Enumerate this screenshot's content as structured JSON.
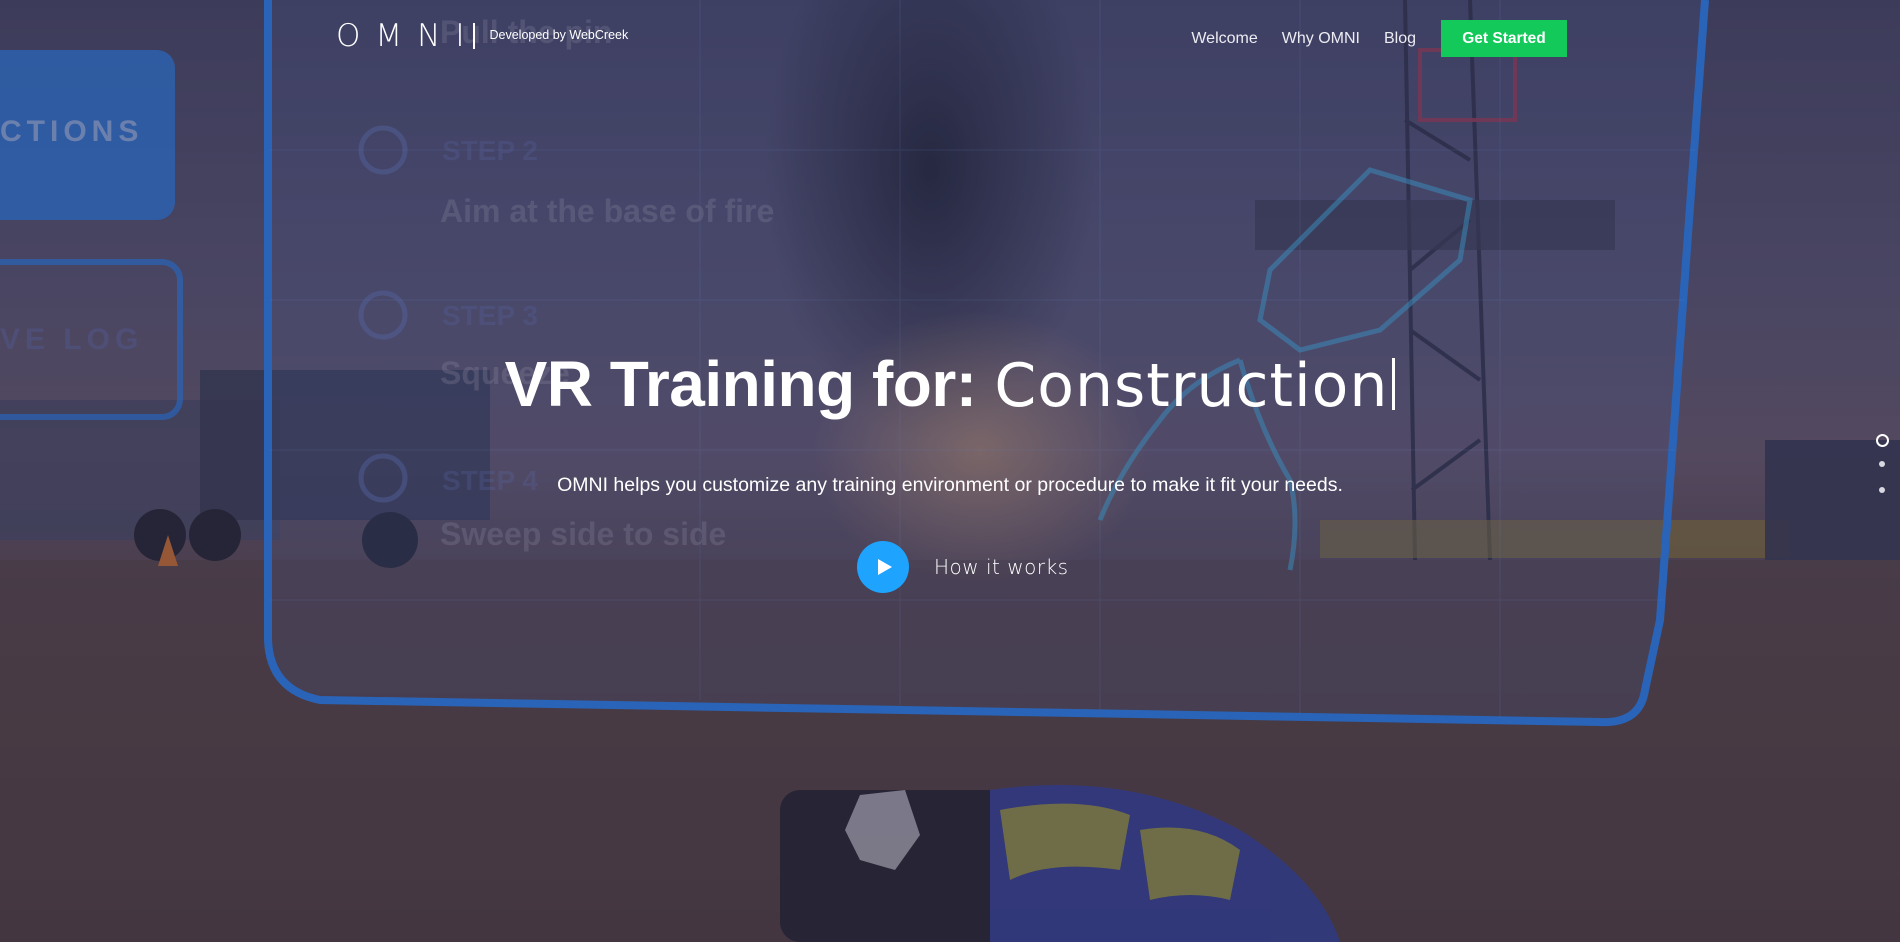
{
  "header": {
    "logo_text": "OMNI",
    "developer_credit": "Developed by WebCreek",
    "nav": [
      {
        "label": "Welcome"
      },
      {
        "label": "Why OMNI"
      },
      {
        "label": "Blog"
      }
    ],
    "cta_label": "Get Started"
  },
  "hero": {
    "headline_prefix": "VR Training for:",
    "headline_typed": "Construction",
    "subline": "OMNI helps you customize any training environment or procedure to make it fit your needs.",
    "how_label": "How it works"
  },
  "background_panel_text": {
    "step_title": "Pull the pin",
    "step2_label": "STEP 2",
    "step2_text": "Aim at the base of fire",
    "step3_label": "STEP 3",
    "step3_text": "Squeeze",
    "step4_label": "STEP 4",
    "step4_text": "Sweep side to side",
    "tab1": "CTIONS",
    "tab2": "VE LOG"
  },
  "slide_dots": {
    "count": 3,
    "active_index": 0
  },
  "colors": {
    "accent_green": "#12c95a",
    "accent_blue": "#1ea4ff",
    "vr_panel_blue": "#2b8cff"
  },
  "icons": {
    "play": "play-icon"
  }
}
